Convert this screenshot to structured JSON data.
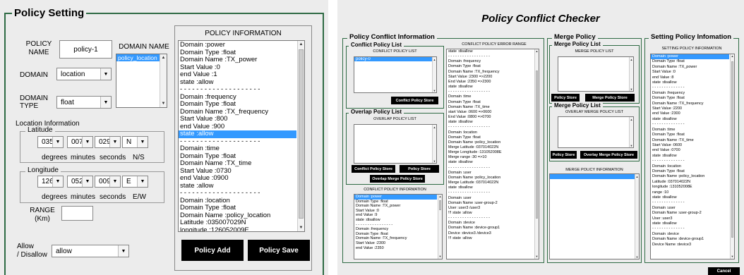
{
  "left": {
    "title": "Policy Setting",
    "policy_name_label": "POLICY\nNAME",
    "policy_name_value": "policy-1",
    "domain_name_label": "DOMAIN NAME",
    "domain_name_items": [
      "policy_location"
    ],
    "domain_label": "DOMAIN",
    "domain_value": "location",
    "domain_type_label": "DOMAIN\nTYPE",
    "domain_type_value": "float",
    "location_info_label": "Location Information",
    "latitude": {
      "label": "Latitude",
      "deg": "035",
      "min": "007",
      "sec": "029",
      "dir": "N",
      "units": [
        "degrees",
        "minutes",
        "seconds",
        "N/S"
      ]
    },
    "longitude": {
      "label": "Longitude",
      "deg": "126",
      "min": "052",
      "sec": "009",
      "dir": "E",
      "units": [
        "degrees",
        "minutes",
        "seconds",
        "E/W"
      ]
    },
    "range_label": "RANGE\n(Km)",
    "allow_label": "Allow\n/ Disallow",
    "allow_value": "allow",
    "policy_info_title": "POLICY INFORMATION",
    "policy_info_lines": [
      "Domain :power",
      "Domain Type :float",
      "Domain Name :TX_power",
      "Start Value :0",
      "end Value :1",
      "state :allow",
      "- - - - - - - - - - - - - - - - - - - -",
      "Domain :frequency",
      "Domain Type :float",
      "Domain Name :TX_frequency",
      "Start Value :800",
      "end Value :900",
      "state :allow",
      "- - - - - - - - - - - - - - - - - - - -",
      "Domain :time",
      "Domain Type :float",
      "Domain Name :TX_time",
      "Start Value :0730",
      "end Value :0900",
      "state :allow",
      "- - - - - - - - - - - - - - - - - - - -",
      "Domain :location",
      "Domain Type :float",
      "Domain Name :policy_location",
      "Latitude :035007029N",
      "longitude :126052009E"
    ],
    "policy_info_selected": 12,
    "policy_add_label": "Policy Add",
    "policy_save_label": "Policy Save"
  },
  "right": {
    "title": "Policy Conflict Checker",
    "conflict_info_title": "Policy Conflict Information",
    "conflict_list_title": "Conflict Policy List",
    "conflict_policy_list_header": "CONFLICT POLICY LIST",
    "conflict_policy_items": [
      "policy-0"
    ],
    "conflict_policy_store_label": "Conflict Policy Store",
    "overlap_list_title": "Overlap Policy List",
    "overlap_policy_list_header": "OVERLAP POLICY LIST",
    "overlap_conflict_store_label": "Conflict Policy Store",
    "overlap_policy_store_label": "Policy Store",
    "overlap_merge_store_label": "Overlap Merge Policy Store",
    "conflict_policy_info_header": "CONFLICT POLICY INFORMATION",
    "conflict_policy_info_lines": [
      "Domain :power",
      "Domain Type :float",
      "Domain Name :TX_power",
      "Start Value :0",
      "end Value :9",
      "state :disallow",
      "- - - - - - - - - - - - - - - -",
      "Domain :frequency",
      "Domain Type :float",
      "Domain Name :TX_frequency",
      "Start Value :2300",
      "end Value :2350"
    ],
    "error_range_header": "CONFLICT POLICY ERROR RANGE",
    "error_range_lines": [
      "state :disallow",
      "- - - - - - - - - - - - - - - - - -",
      "Domain :frequency",
      "Domain Type :float",
      "Domain Name :TX_frequency",
      "Start Value :2300 =>2200",
      "End Value :2350 =>2300",
      "state :disallow",
      "- - - - - - - - - - - - - - - - - -",
      "Domain :time",
      "Domain Type :float",
      "Domain Name :TX_time",
      "start Value :0600 =>0600",
      "End Value :0800 =>0700",
      "state :disallow",
      "- - - - - - - - - - - - - - - - - -",
      "Domain :location",
      "Domain Type :float",
      "Domain Name :policy_location",
      "Merge Latitude :037014022N",
      "Merge Longitude :131052008E",
      "Merge range :30 =>10",
      "state :disallow",
      "- - - - - - - - - - - - - - - - - -",
      "Domain :user",
      "Domain Name :policy_location",
      "Merge Latitude :037014022N",
      "state :disallow",
      "- - - - - - - - - - - - - - - - - -",
      "Domain :user",
      "Domain Name :user-group-2",
      "User :user3  /user3",
      "!!! state :allow",
      "- - - - - - - - - - - - - - - - - -",
      "Domain :device",
      "Domain Name :device-group1",
      "Device :device3  /device3",
      "!!! state :allow"
    ],
    "merge_policy_title": "Merge Policy",
    "merge_policy_list_title": "Merge Policy List",
    "merge_policy_list_header": "MERGE POLICY LIST",
    "merge_policy_store_label": "Policy Store",
    "merge_merge_store_label": "Merge Policy Store",
    "merge_policy_list2_title": "Merge Policy List",
    "overlay_merge_header": "OVERLAY MERGE POLICY LIST",
    "overlay_policy_store_label": "Policy Store",
    "overlay_merge_store_label": "Overlay Merge Policy Store",
    "merge_policy_info_header": "MERGE POLICY INFORMATION",
    "setting_info_title": "Setting Policy Infomation",
    "setting_info_header": "SETTING POLICY INFORMATION",
    "setting_info_lines": [
      "Domain :power",
      "Domain Type :float",
      "Domain Name :TX_power",
      "Start Value :0",
      "end Value :8",
      "state :disallow",
      "- - - - - - - - - - - - - -",
      "Domain :frequency",
      "Domain Type :float",
      "Domain Name :TX_frequency",
      "Start Value :2200",
      "end Value :2300",
      "state :disallow",
      "- - - - - - - - - - - - - -",
      "Domain :time",
      "Domain Type :float",
      "Domain Name :TX_time",
      "Start Value :0600",
      "end Value :0700",
      "state :disallow",
      "- - - - - - - - - - - - - -",
      "Domain :location",
      "Domain Type :float",
      "Domain Name :policy_location",
      "Latitude :037014022N",
      "longitude :131052008E",
      "range :10",
      "state :disallow",
      "- - - - - - - - - - - - - -",
      "Domain :user",
      "Domain Name :user-group-2",
      "User :user3",
      "state :disallow",
      "- - - - - - - - - - - - - -",
      "Domain :device",
      "Domain Name :device-group1",
      "Device Name :device3"
    ],
    "cancel_label": "Cancel"
  }
}
